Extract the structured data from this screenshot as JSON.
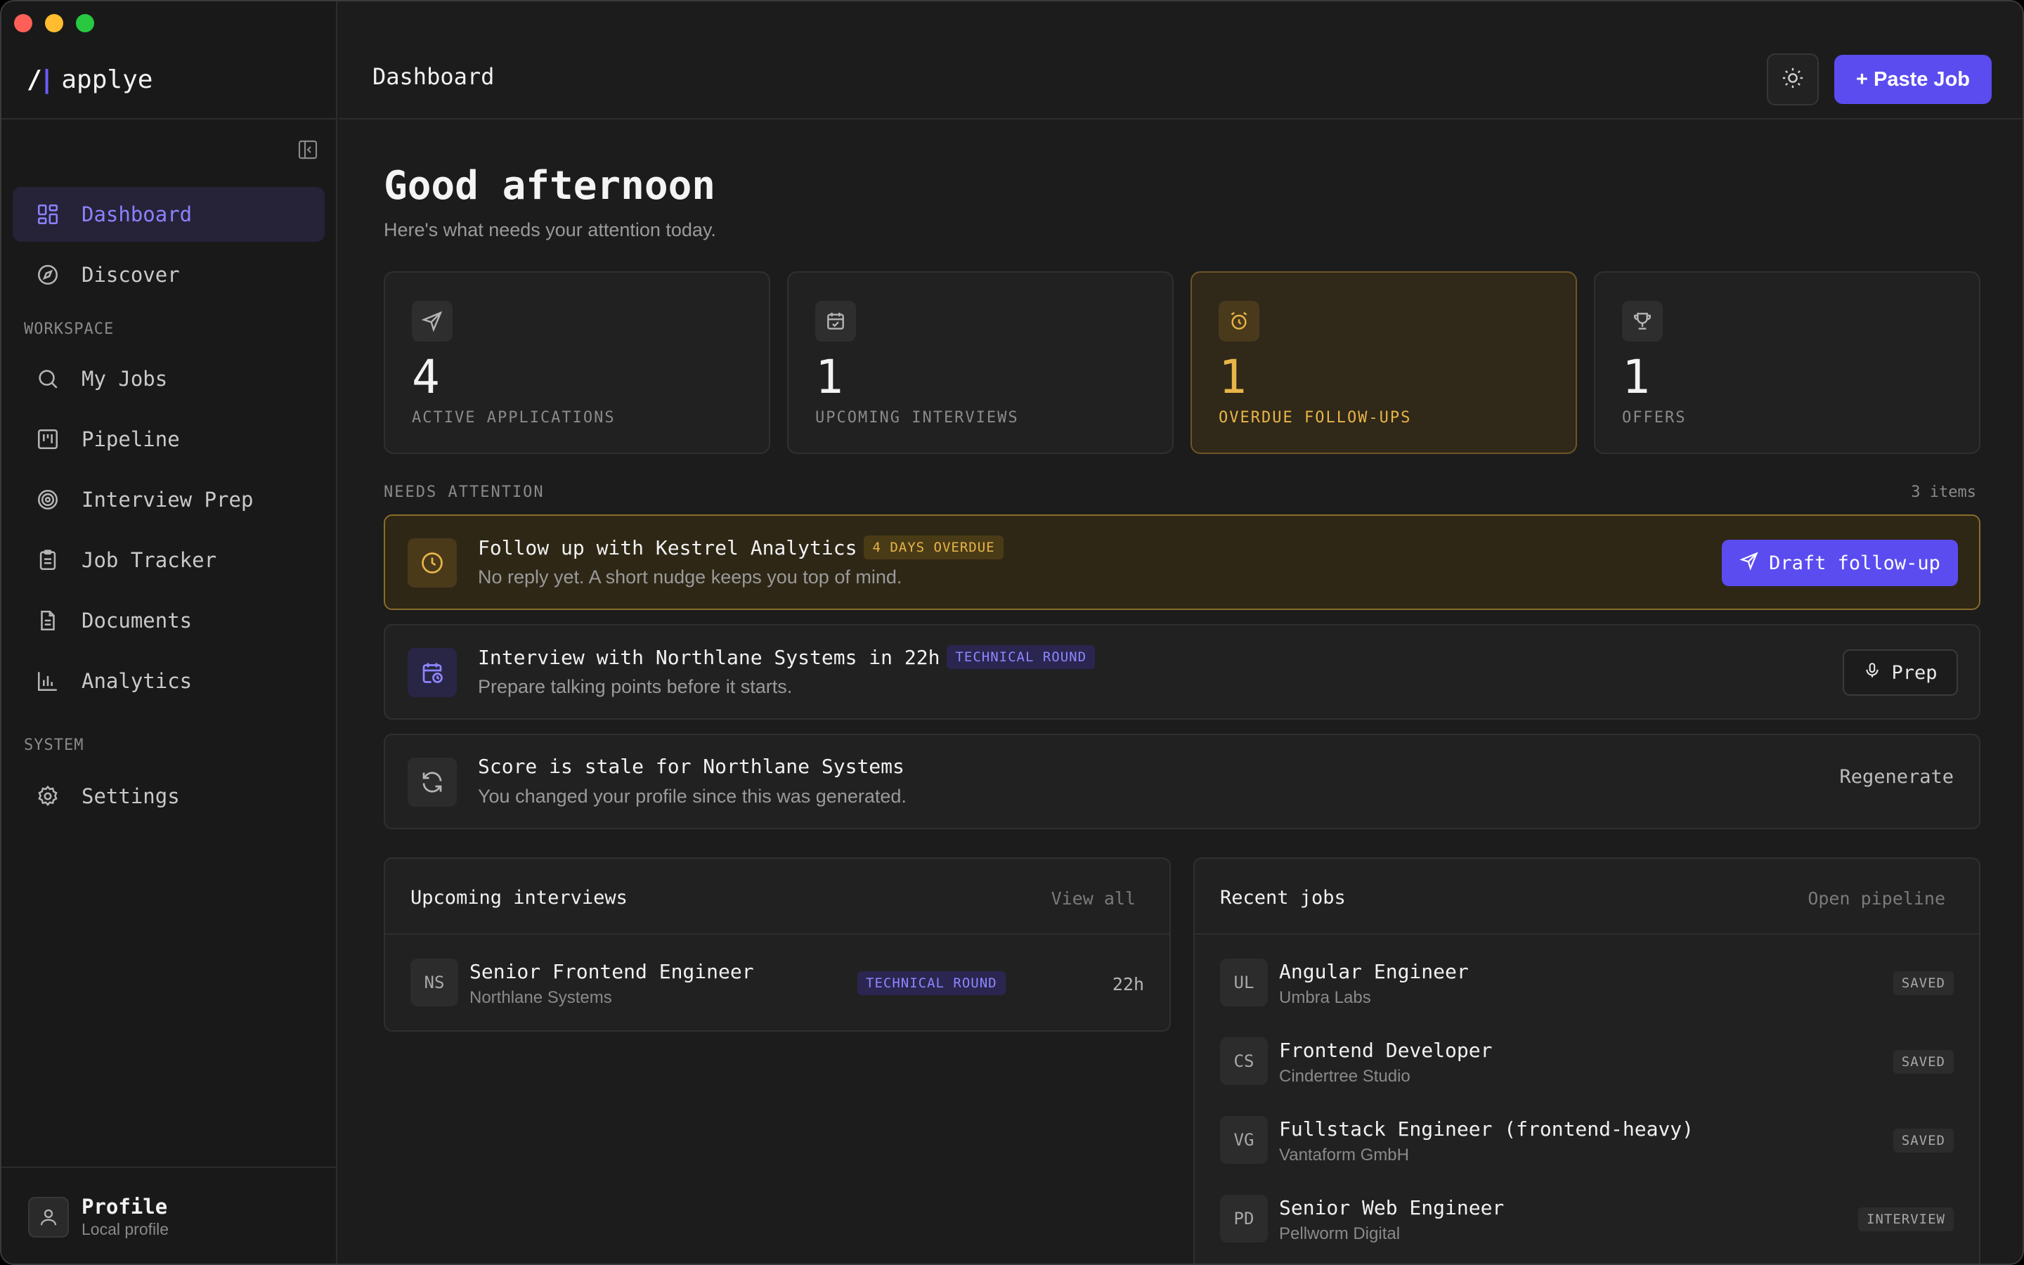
{
  "brand": {
    "mark_slash": "/",
    "mark_bar": "|",
    "name": "applye"
  },
  "sidebar": {
    "primary": [
      {
        "label": "Dashboard",
        "icon": "grid-icon",
        "active": true
      },
      {
        "label": "Discover",
        "icon": "compass-icon"
      }
    ],
    "workspace_label": "WORKSPACE",
    "workspace": [
      {
        "label": "My Jobs",
        "icon": "search-icon"
      },
      {
        "label": "Pipeline",
        "icon": "kanban-icon"
      },
      {
        "label": "Interview Prep",
        "icon": "target-icon"
      },
      {
        "label": "Job Tracker",
        "icon": "clipboard-icon"
      },
      {
        "label": "Documents",
        "icon": "document-icon"
      },
      {
        "label": "Analytics",
        "icon": "bar-chart-icon"
      }
    ],
    "system_label": "SYSTEM",
    "system": [
      {
        "label": "Settings",
        "icon": "gear-icon"
      }
    ],
    "profile": {
      "name": "Profile",
      "subtitle": "Local profile"
    }
  },
  "topbar": {
    "title": "Dashboard",
    "paste_job_label": "+ Paste Job"
  },
  "greeting": {
    "title": "Good afternoon",
    "subtitle": "Here's what needs your attention today."
  },
  "stats": [
    {
      "value": "4",
      "label": "ACTIVE APPLICATIONS",
      "icon": "send-icon"
    },
    {
      "value": "1",
      "label": "UPCOMING INTERVIEWS",
      "icon": "calendar-icon"
    },
    {
      "value": "1",
      "label": "OVERDUE FOLLOW-UPS",
      "icon": "alarm-clock-icon",
      "highlight": "#e7b549"
    },
    {
      "value": "1",
      "label": "OFFERS",
      "icon": "trophy-icon"
    }
  ],
  "attention": {
    "label": "NEEDS ATTENTION",
    "count": "3 items",
    "items": [
      {
        "title": "Follow up with Kestrel Analytics",
        "badge": "4 DAYS OVERDUE",
        "subtitle": "No reply yet. A short nudge keeps you top of mind.",
        "action": "Draft follow-up"
      },
      {
        "title": "Interview with Northlane Systems in 22h",
        "badge": "TECHNICAL ROUND",
        "subtitle": "Prepare talking points before it starts.",
        "action": "Prep"
      },
      {
        "title": "Score is stale for Northlane Systems",
        "subtitle": "You changed your profile since this was generated.",
        "action": "Regenerate"
      }
    ]
  },
  "upcoming": {
    "title": "Upcoming interviews",
    "link": "View all",
    "rows": [
      {
        "initials": "NS",
        "title": "Senior Frontend Engineer",
        "company": "Northlane Systems",
        "badge": "TECHNICAL ROUND",
        "time": "22h"
      }
    ]
  },
  "recent": {
    "title": "Recent jobs",
    "link": "Open pipeline",
    "rows": [
      {
        "initials": "UL",
        "title": "Angular Engineer",
        "company": "Umbra Labs",
        "status": "SAVED"
      },
      {
        "initials": "CS",
        "title": "Frontend Developer",
        "company": "Cindertree Studio",
        "status": "SAVED"
      },
      {
        "initials": "VG",
        "title": "Fullstack Engineer (frontend-heavy)",
        "company": "Vantaform GmbH",
        "status": "SAVED"
      },
      {
        "initials": "PD",
        "title": "Senior Web Engineer",
        "company": "Pellworm Digital",
        "status": "INTERVIEW"
      }
    ]
  },
  "colors": {
    "accent": "#5b4cf0",
    "warning": "#e7b549",
    "background": "#1c1c1c"
  }
}
